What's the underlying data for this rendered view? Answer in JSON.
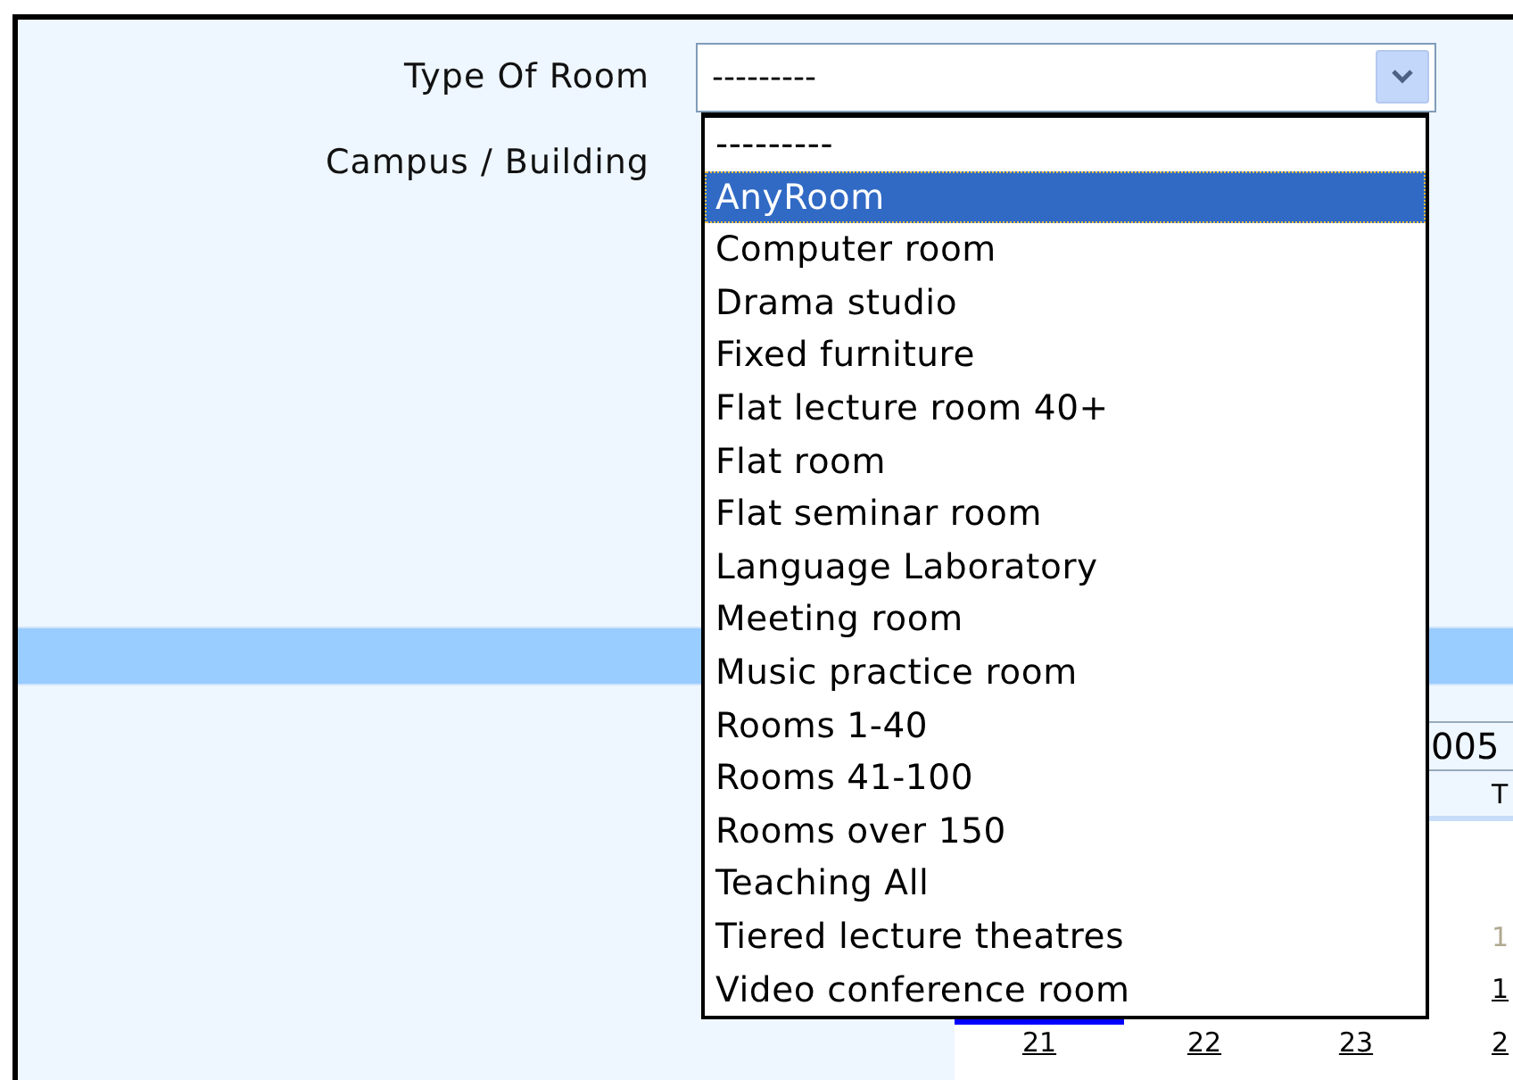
{
  "form": {
    "fields": [
      {
        "label": "Type Of Room",
        "value": "---------"
      },
      {
        "label": "Campus / Building"
      }
    ]
  },
  "dropdown": {
    "options": [
      {
        "label": "---------",
        "selected": false
      },
      {
        "label": "AnyRoom",
        "selected": true
      },
      {
        "label": "Computer room",
        "selected": false
      },
      {
        "label": "Drama studio",
        "selected": false
      },
      {
        "label": "Fixed furniture",
        "selected": false
      },
      {
        "label": "Flat lecture room 40+",
        "selected": false
      },
      {
        "label": "Flat room",
        "selected": false
      },
      {
        "label": "Flat seminar room",
        "selected": false
      },
      {
        "label": "Language Laboratory",
        "selected": false
      },
      {
        "label": "Meeting room",
        "selected": false
      },
      {
        "label": "Music practice room",
        "selected": false
      },
      {
        "label": "Rooms 1-40",
        "selected": false
      },
      {
        "label": "Rooms 41-100",
        "selected": false
      },
      {
        "label": "Rooms over 150",
        "selected": false
      },
      {
        "label": "Teaching All",
        "selected": false
      },
      {
        "label": "Tiered lecture theatres",
        "selected": false
      },
      {
        "label": "Video conference room",
        "selected": false
      }
    ]
  },
  "calendar": {
    "year_field": "005",
    "weekday_header": "T",
    "column_4_days": [
      {
        "label": "1",
        "muted": true
      },
      {
        "label": "1",
        "muted": false
      }
    ],
    "last_row": [
      "21",
      "22",
      "23",
      "2"
    ]
  }
}
